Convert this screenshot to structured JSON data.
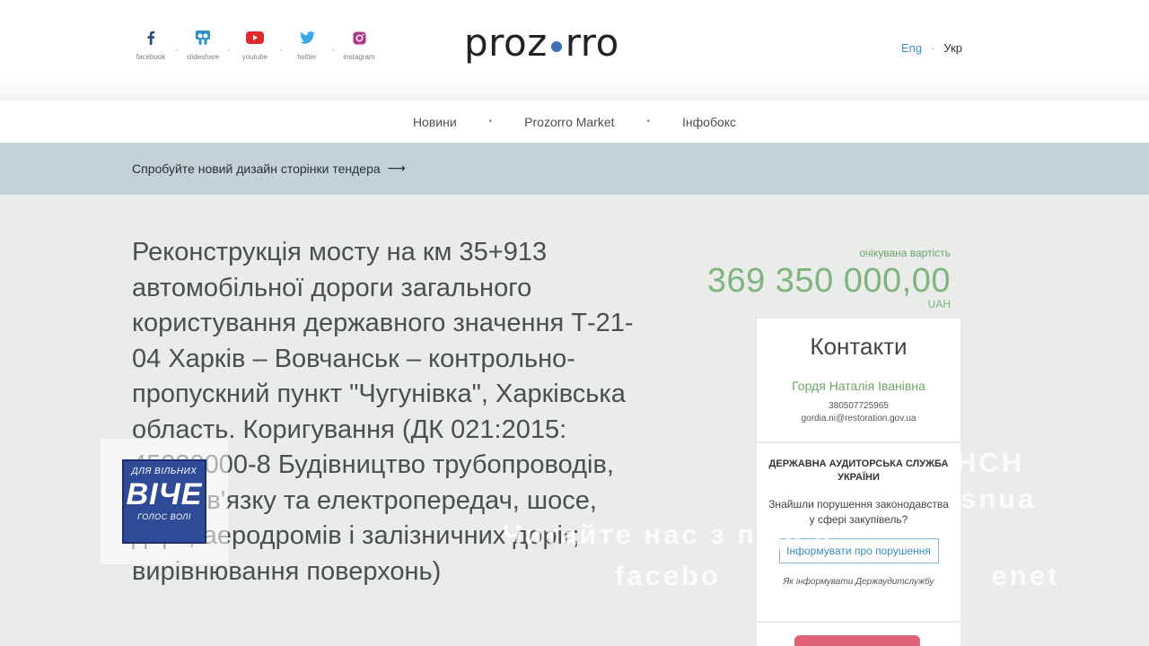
{
  "social": [
    {
      "label": "facebook",
      "icon": "facebook-icon",
      "color": "#2b4a7e"
    },
    {
      "label": "slideshare",
      "icon": "slideshare-icon",
      "color": "#2f8fc7"
    },
    {
      "label": "youtube",
      "icon": "youtube-icon",
      "color": "#e02a2a"
    },
    {
      "label": "twitter",
      "icon": "twitter-icon",
      "color": "#3aa7e8"
    },
    {
      "label": "instagram",
      "icon": "instagram-icon",
      "color": "#b5338a"
    }
  ],
  "logo": {
    "left": "proz",
    "right": "rro"
  },
  "lang": {
    "eng": "Eng",
    "ukr": "Укр"
  },
  "nav": [
    "Новини",
    "Prozorro Market",
    "Інфобокс"
  ],
  "banner": {
    "text": "Спробуйте новий дизайн сторінки тендера",
    "arrow": "⟶"
  },
  "tender": {
    "title": "Реконструкція мосту на км 35+913 автомобільної дороги загального користування державного значення Т-21-04 Харків – Вовчанськ – контрольно-пропускний пункт \"Чугунівка\", Харківська область. Коригування (ДК 021:2015: 45230000-8 Будівництво трубопроводів, ліній зв'язку та електропередач, шосе, доріг, аеродромів і залізничних доріг; вирівнювання поверхонь)",
    "price_label": "очікувана вартість",
    "price": "369 350 000,00",
    "currency": "UAH"
  },
  "contacts": {
    "heading": "Контакти",
    "name": "Гордя Наталія Іванівна",
    "phone": "380507725965",
    "email": "gordia.ni@restoration.gov.ua"
  },
  "audit": {
    "heading": "ДЕРЖАВНА АУДИТОРСЬКА СЛУЖБА УКРАЇНИ",
    "question": "Знайшли порушення законодавства у сфері закупівель?",
    "button": "Інформувати про порушення",
    "note": "Як інформувати Держаудитслужбу"
  },
  "badge": {
    "top": "ДЛЯ ВІЛЬНИХ",
    "middle": "ВІЧЕ",
    "bottom": "ГОЛОС ВОЛІ"
  },
  "watermark": {
    "line1": "НСН",
    "line2": "snua",
    "line3": "Читайте нас з перел",
    "line4": "facebo enet"
  }
}
